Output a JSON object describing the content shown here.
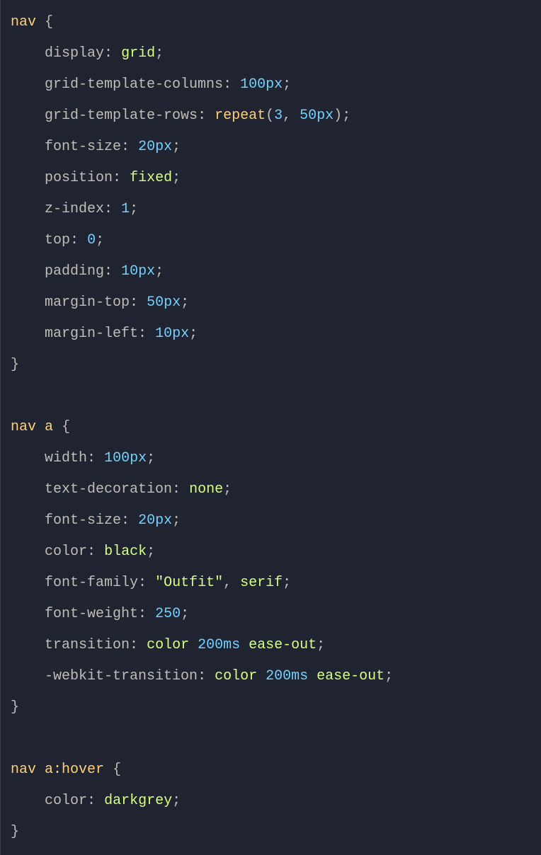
{
  "rules": [
    {
      "selector": "nav",
      "declarations": [
        {
          "property": "display",
          "value": "grid",
          "valueType": "green"
        },
        {
          "property": "grid-template-columns",
          "value": "100px",
          "valueType": "blue"
        },
        {
          "property": "grid-template-rows",
          "value": "repeat(3, 50px)",
          "valueType": "function"
        },
        {
          "property": "font-size",
          "value": "20px",
          "valueType": "blue"
        },
        {
          "property": "position",
          "value": "fixed",
          "valueType": "green"
        },
        {
          "property": "z-index",
          "value": "1",
          "valueType": "blue"
        },
        {
          "property": "top",
          "value": "0",
          "valueType": "blue"
        },
        {
          "property": "padding",
          "value": "10px",
          "valueType": "blue"
        },
        {
          "property": "margin-top",
          "value": "50px",
          "valueType": "blue"
        },
        {
          "property": "margin-left",
          "value": "10px",
          "valueType": "blue"
        }
      ]
    },
    {
      "selector": "nav a",
      "declarations": [
        {
          "property": "width",
          "value": "100px",
          "valueType": "blue"
        },
        {
          "property": "text-decoration",
          "value": "none",
          "valueType": "green"
        },
        {
          "property": "font-size",
          "value": "20px",
          "valueType": "blue"
        },
        {
          "property": "color",
          "value": "black",
          "valueType": "green"
        },
        {
          "property": "font-family",
          "value": "\"Outfit\", serif",
          "valueType": "fontfamily"
        },
        {
          "property": "font-weight",
          "value": "250",
          "valueType": "blue"
        },
        {
          "property": "transition",
          "value": "color 200ms ease-out",
          "valueType": "transition"
        },
        {
          "property": "-webkit-transition",
          "value": "color 200ms ease-out",
          "valueType": "transition"
        }
      ]
    },
    {
      "selector": "nav a:hover",
      "declarations": [
        {
          "property": "color",
          "value": "darkgrey",
          "valueType": "green"
        }
      ]
    }
  ]
}
